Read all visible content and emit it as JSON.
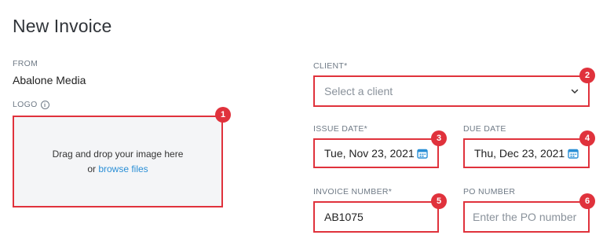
{
  "page": {
    "title": "New Invoice"
  },
  "from": {
    "label": "FROM",
    "value": "Abalone Media"
  },
  "logo": {
    "label": "LOGO",
    "info_glyph": "i",
    "dropzone_text": "Drag and drop your image here",
    "or_text": "or ",
    "browse_link": "browse files"
  },
  "client": {
    "label": "CLIENT*",
    "placeholder": "Select a client"
  },
  "issue_date": {
    "label": "ISSUE DATE*",
    "value": "Tue, Nov 23, 2021"
  },
  "due_date": {
    "label": "DUE DATE",
    "value": "Thu, Dec 23, 2021"
  },
  "invoice_number": {
    "label": "INVOICE NUMBER*",
    "value": "AB1075"
  },
  "po_number": {
    "label": "PO NUMBER",
    "placeholder": "Enter the PO number"
  },
  "badges": [
    "1",
    "2",
    "3",
    "4",
    "5",
    "6"
  ],
  "icons": {
    "calendar": "calendar-icon",
    "chevron": "chevron-down-icon",
    "info": "info-icon"
  },
  "colors": {
    "highlight": "#e0323c",
    "link": "#2a8fd6",
    "calendar": "#2a8fd6",
    "dropzone_bg": "#f4f5f7"
  }
}
